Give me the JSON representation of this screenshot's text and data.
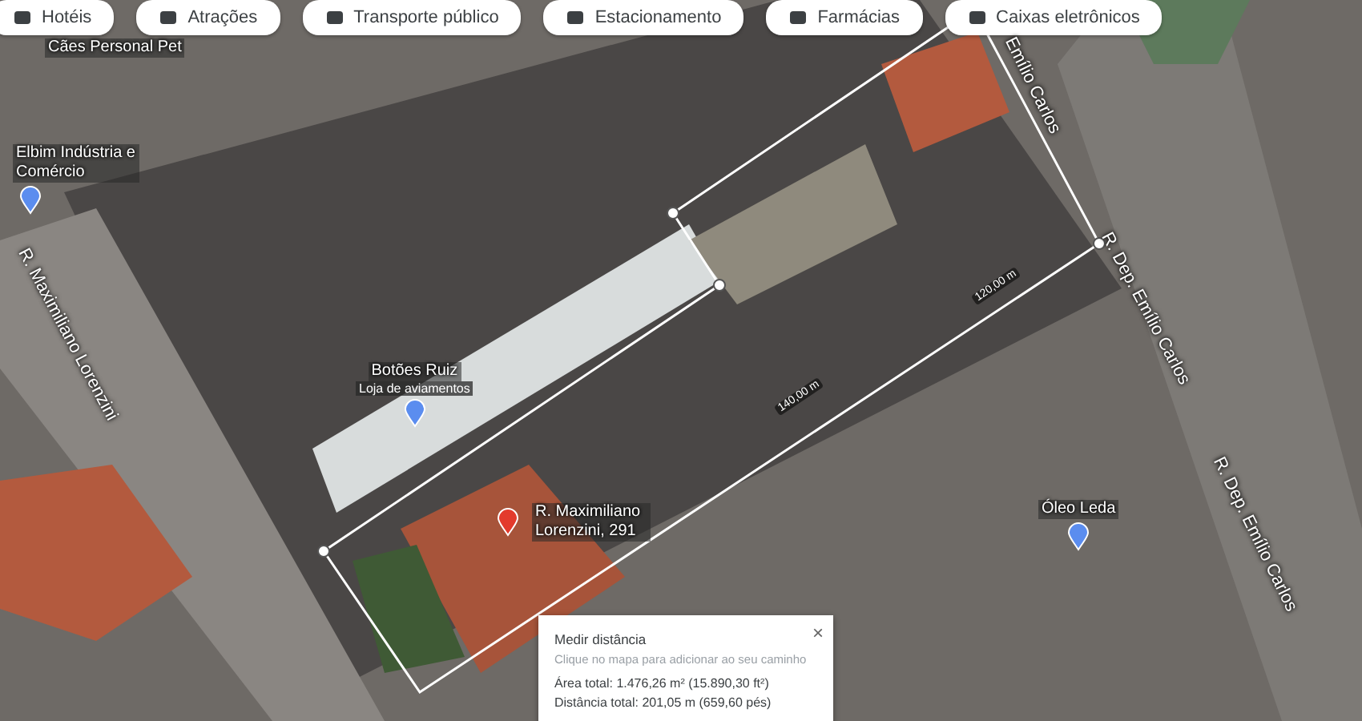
{
  "filter_chips": [
    {
      "label": "Hotéis"
    },
    {
      "label": "Atrações"
    },
    {
      "label": "Transporte público"
    },
    {
      "label": "Estacionamento"
    },
    {
      "label": "Farmácias"
    },
    {
      "label": "Caixas eletrônicos"
    }
  ],
  "places": [
    {
      "kind": "label",
      "name": "Cães Personal Pet"
    },
    {
      "kind": "pin",
      "name": "Elbim Indústria e Comércio"
    },
    {
      "kind": "pin",
      "name": "Botões Ruiz",
      "category": "Loja de aviamentos"
    },
    {
      "kind": "dropped-pin",
      "name": "R. Maximiliano Lorenzini, 291"
    },
    {
      "kind": "pin",
      "name": "Óleo Leda"
    }
  ],
  "streets": [
    {
      "name": "R. Maximiliano Lorenzini"
    },
    {
      "name": "Emílio Carlos"
    },
    {
      "name": "R. Dep. Emílio Carlos"
    },
    {
      "name": "R. Dep. Emílio Carlos"
    }
  ],
  "segment_labels": [
    {
      "text": "120,00 m"
    },
    {
      "text": "140,00 m"
    }
  ],
  "measure_panel": {
    "title": "Medir distância",
    "hint": "Clique no mapa para adicionar ao seu caminho",
    "close": "×",
    "area": "Área total: 1.476,26 m² (15.890,30 ft²)",
    "distance": "Distância total: 201,05 m (659,60 pés)"
  }
}
